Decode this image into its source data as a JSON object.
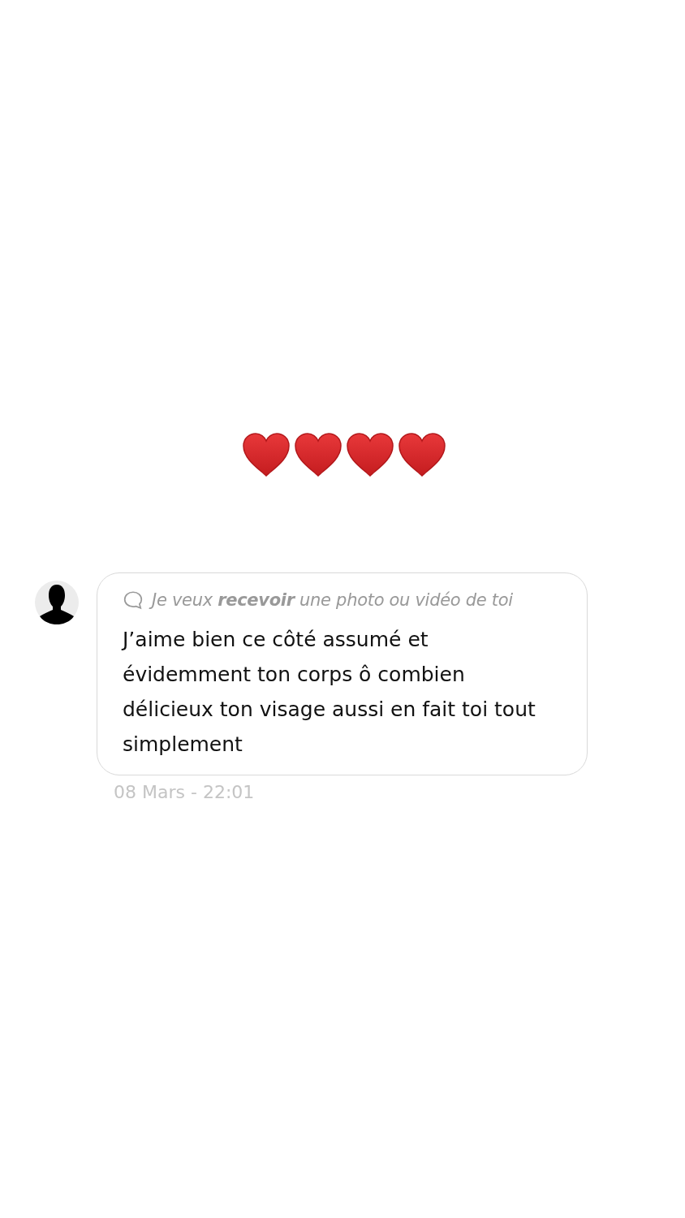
{
  "reactions": [
    {
      "kind": "heart"
    },
    {
      "kind": "heart"
    },
    {
      "kind": "heart"
    },
    {
      "kind": "heart"
    }
  ],
  "message": {
    "quote": "Je veux **recevoir** une photo ou vidéo de toi",
    "text": "J’aime bien ce côté assumé et évidemment ton corps ô combien délicieux ton visage aussi en fait toi tout simplement",
    "timestamp": "08 Mars - 22:01"
  }
}
